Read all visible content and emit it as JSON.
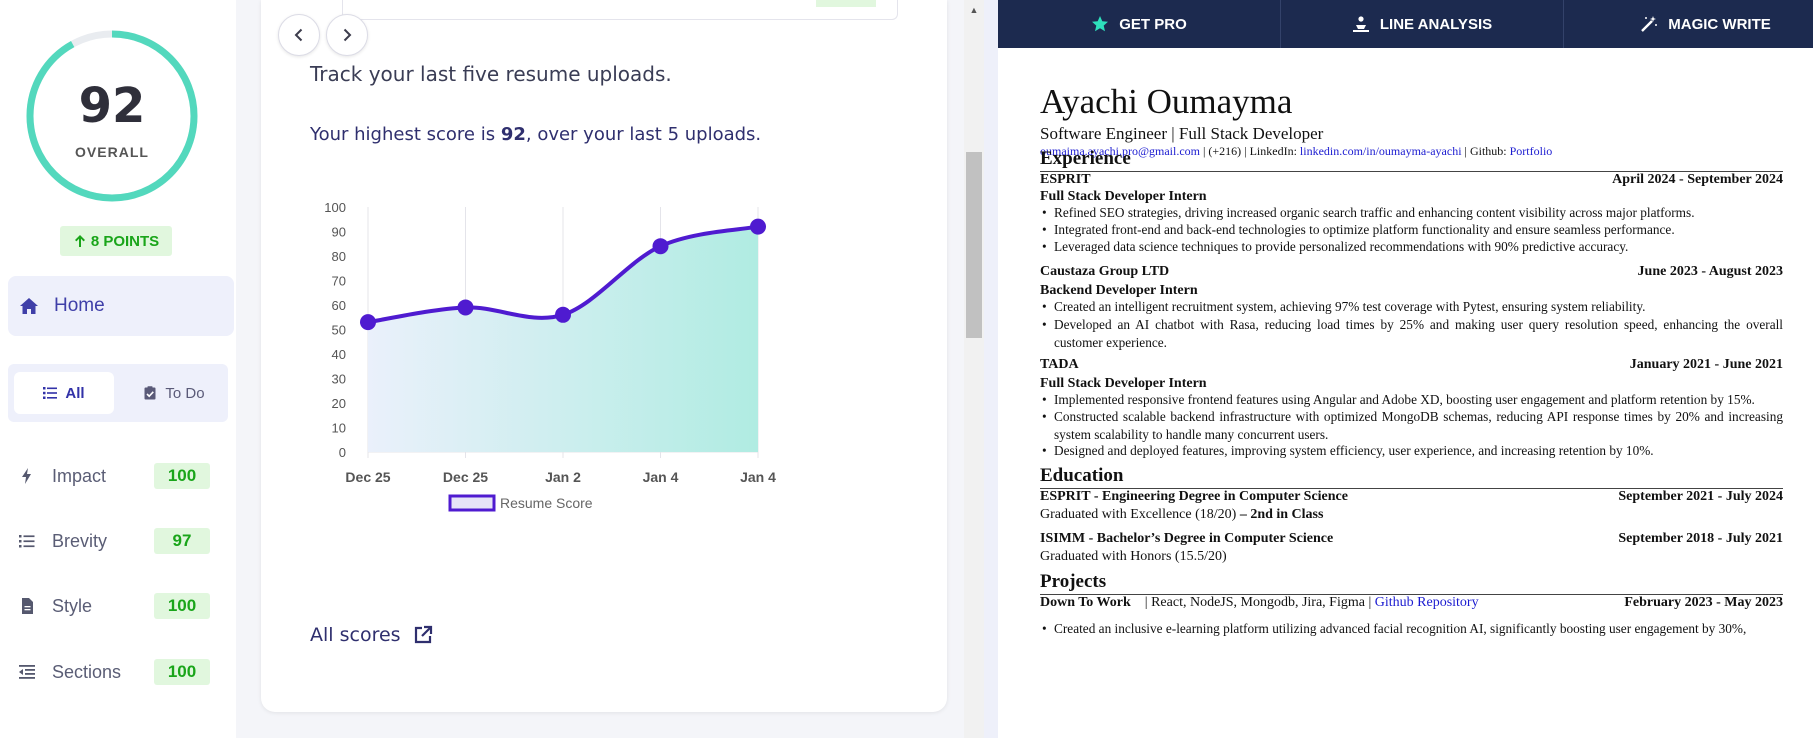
{
  "sidebar": {
    "score": "92",
    "score_caption": "OVERALL",
    "score_fraction": 0.92,
    "points_badge": "8 POINTS",
    "home_label": "Home",
    "tabs": [
      {
        "label": "All",
        "icon": "list-icon"
      },
      {
        "label": "To Do",
        "icon": "clipboard-check-icon"
      }
    ],
    "categories": [
      {
        "label": "Impact",
        "score": "100",
        "icon": "bolt-icon"
      },
      {
        "label": "Brevity",
        "score": "97",
        "icon": "list-icon"
      },
      {
        "label": "Style",
        "score": "100",
        "icon": "document-icon"
      },
      {
        "label": "Sections",
        "score": "100",
        "icon": "outdent-icon"
      }
    ]
  },
  "middle": {
    "track_text": "Track your last five resume uploads.",
    "highest_prefix": "Your highest score is ",
    "highest_value": "92",
    "highest_suffix": ", over your last 5 uploads.",
    "all_scores_label": "All scores"
  },
  "chart_data": {
    "type": "area",
    "categories": [
      "Dec 25",
      "Dec 25",
      "Jan 2",
      "Jan 4",
      "Jan 4"
    ],
    "series": [
      {
        "name": "Resume Score",
        "values": [
          53,
          59,
          56,
          84,
          92
        ]
      }
    ],
    "ylim": [
      0,
      100
    ],
    "yticks": [
      0,
      10,
      20,
      30,
      40,
      50,
      60,
      70,
      80,
      90,
      100
    ],
    "grid": "vertical",
    "legend": "bottom",
    "colors": {
      "line": "#4f1bd0",
      "fill_start": "#eaf0fb",
      "fill_end": "#b0ece2"
    }
  },
  "toolbar": {
    "items": [
      {
        "label": "GET PRO",
        "icon": "star-icon"
      },
      {
        "label": "LINE ANALYSIS",
        "icon": "line-analysis-icon"
      },
      {
        "label": "MAGIC WRITE",
        "icon": "magic-wand-icon"
      }
    ]
  },
  "resume": {
    "name": "Ayachi Oumayma",
    "title": "Software Engineer | Full Stack Developer",
    "contact": {
      "email": "oumaima.ayachi.pro@gmail.com",
      "phone": "(+216) ",
      "linkedin_label": "LinkedIn: ",
      "linkedin": "linkedin.com/in/oumayma-ayachi",
      "github_label": "Github: ",
      "portfolio": "Portfolio"
    },
    "experience_title": "Experience",
    "experience": [
      {
        "org": "ESPRIT",
        "dates": "April 2024 - September 2024",
        "role": "Full Stack Developer Intern",
        "bullets": [
          "Refined SEO strategies, driving increased organic search traffic and enhancing content visibility across major platforms.",
          "Integrated front-end and back-end technologies to optimize platform functionality and ensure seamless performance.",
          "Leveraged data science techniques to provide personalized recommendations with 90% predictive accuracy."
        ]
      },
      {
        "org": "Caustaza Group LTD",
        "dates": "June 2023 - August 2023",
        "role": "Backend Developer Intern",
        "bullets": [
          "Created an intelligent recruitment system, achieving 97% test coverage with Pytest, ensuring system reliability.",
          "Developed an AI chatbot with Rasa, reducing load times by 25% and making user query resolution speed, enhancing the overall customer experience."
        ]
      },
      {
        "org": "TADA",
        "dates": "January 2021 - June 2021",
        "role": "Full Stack Developer Intern",
        "bullets": [
          "Implemented responsive frontend features using Angular and Adobe XD, boosting user engagement and platform retention by 15%.",
          "Constructed scalable backend infrastructure with optimized MongoDB schemas, reducing API response times by 20% and increasing system scalability to handle many concurrent users.",
          "Designed and deployed features, improving system efficiency, user experience, and increasing retention by 10%."
        ]
      }
    ],
    "education_title": "Education",
    "education": [
      {
        "school": "ESPRIT - Engineering Degree in Computer Science",
        "dates": "September 2021 - July 2024",
        "detail": "Graduated with Excellence (18/20)",
        "detail_bold": " – 2nd in Class"
      },
      {
        "school": "ISIMM - Bachelor’s Degree in Computer Science",
        "dates": "September 2018 - July 2021",
        "detail": "Graduated with Honors (15.5/20)",
        "detail_bold": ""
      }
    ],
    "projects_title": "Projects",
    "project": {
      "name": "Down To Work",
      "stack": "| React, NodeJS, Mongodb, Jira, Figma | ",
      "link": "Github Repository",
      "dates": "February 2023 - May 2023",
      "bullet": "Created an inclusive e-learning platform utilizing advanced facial recognition AI, significantly boosting user engagement by 30%,"
    }
  }
}
